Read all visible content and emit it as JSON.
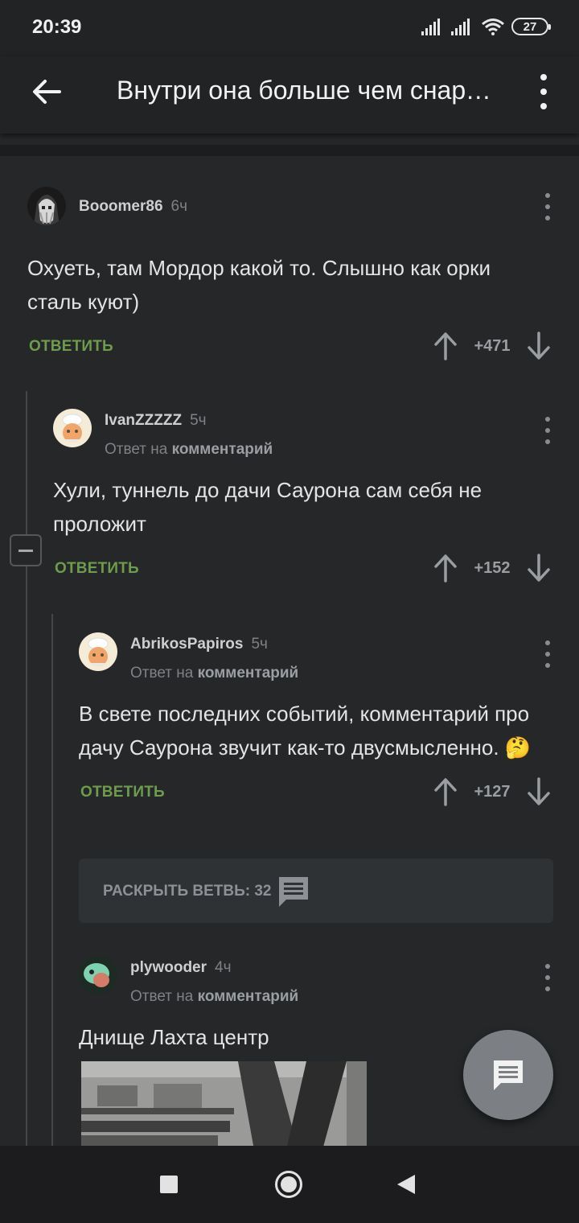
{
  "status": {
    "time": "20:39",
    "battery": "27"
  },
  "header": {
    "title": "Внутри она больше чем снаружи"
  },
  "comments": [
    {
      "user": "Booomer86",
      "time": "6ч",
      "reply_to_prefix": "",
      "reply_to_link": "",
      "text": "Охуеть, там Мордор какой то. Слышно как орки сталь куют)",
      "reply_label": "ОТВЕТИТЬ",
      "votes": "+471"
    },
    {
      "user": "IvanZZZZZ",
      "time": "5ч",
      "reply_to_prefix": "Ответ на",
      "reply_to_link": "комментарий",
      "text": "Хули, туннель до дачи Саурона сам себя не проложит",
      "reply_label": "ОТВЕТИТЬ",
      "votes": "+152"
    },
    {
      "user": "AbrikosPapiros",
      "time": "5ч",
      "reply_to_prefix": "Ответ на",
      "reply_to_link": "комментарий",
      "text": "В свете последних событий, комментарий про дачу Саурона звучит как-то двусмысленно. 🤔",
      "reply_label": "ОТВЕТИТЬ",
      "votes": "+127"
    },
    {
      "user": "plywooder",
      "time": "4ч",
      "reply_to_prefix": "Ответ на",
      "reply_to_link": "комментарий",
      "text": "Днище Лахта центр"
    }
  ],
  "expand_branch": {
    "label": "РАСКРЫТЬ ВЕТВЬ: 32"
  },
  "icons": {
    "back": "arrow-left-icon",
    "menu": "more-vert-icon",
    "upvote": "arrow-up-icon",
    "downvote": "arrow-down-icon",
    "comment_fab": "chat-icon"
  },
  "colors": {
    "background": "#252729",
    "reply_accent": "#6c9c4c",
    "muted": "#7e8185"
  }
}
